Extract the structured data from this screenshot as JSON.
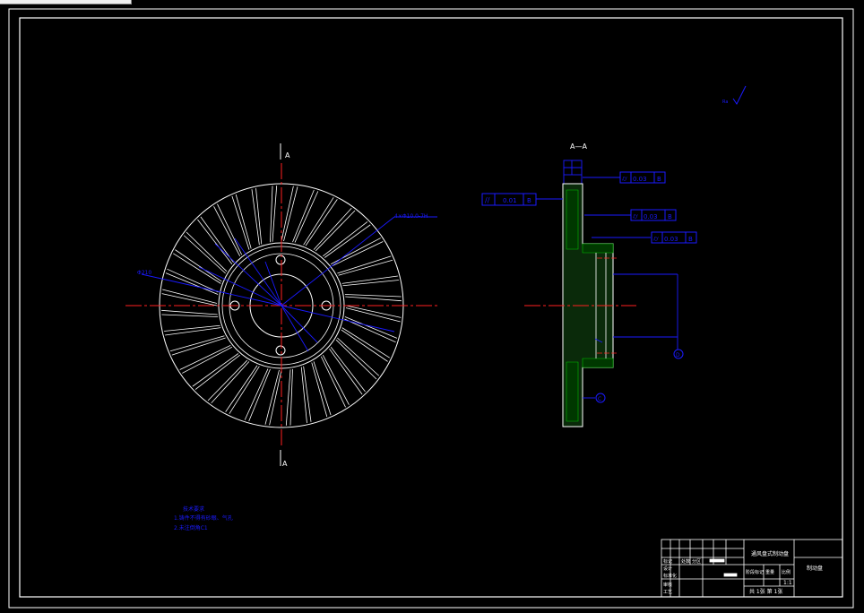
{
  "section_label": "A",
  "section_view_title": "A—A",
  "hole_callout": "4×Φ10.0-7H",
  "left_callout": "Φ210",
  "roughness": "Ra",
  "gdt": {
    "top": {
      "tolerance": "0.03",
      "datum": "B"
    },
    "left": {
      "tolerance": "0.01",
      "datum": "B"
    },
    "mid": {
      "tolerance": "0.03",
      "datum": "B"
    },
    "lower": {
      "tolerance": "0.03",
      "datum": "B"
    }
  },
  "datum_c": "C",
  "datum_d": "D",
  "notes": {
    "heading": "技术要求",
    "line1": "1.铸件不得有砂眼、气孔",
    "line2": "2.未注倒角C1"
  },
  "title_block": {
    "part_name": "通风盘式制动盘",
    "company": "制动盘",
    "scale": "1:1",
    "sheet": "共 1张  第 1张",
    "labels": [
      "标记",
      "处数",
      "分区",
      "设计",
      "标准化",
      "审核",
      "工艺",
      "阶段标记",
      "重量",
      "比例"
    ]
  },
  "colors": {
    "frame": "#ffffff",
    "annotation": "#1a1aff",
    "centerline": "#ff2020",
    "section": "#00c000"
  }
}
